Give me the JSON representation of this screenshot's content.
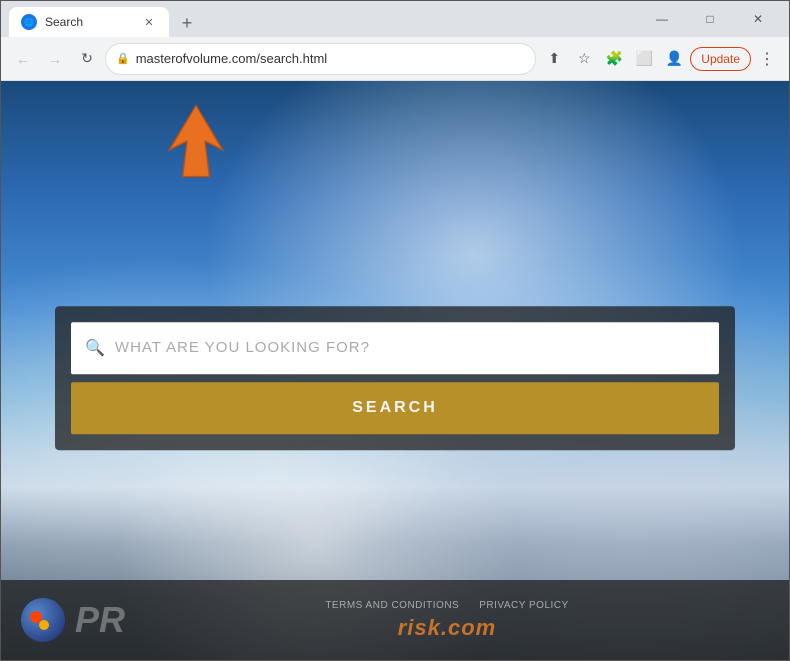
{
  "browser": {
    "tab": {
      "title": "Search",
      "favicon": "🌐"
    },
    "new_tab_label": "+",
    "window_controls": {
      "minimize": "—",
      "maximize": "□",
      "close": "✕"
    },
    "toolbar": {
      "back_label": "←",
      "forward_label": "→",
      "reload_label": "↻",
      "address": "masterofvolume.com/search.html",
      "share_label": "⬆",
      "bookmark_label": "☆",
      "extensions_label": "🧩",
      "tabs_label": "⬜",
      "profile_label": "👤",
      "update_label": "Update",
      "menu_label": "⋮"
    }
  },
  "page": {
    "search": {
      "placeholder": "WHAT ARE YOU LOOKING FOR?",
      "button_label": "SEARCH"
    },
    "footer": {
      "terms_label": "TERMS AND CONDITIONS",
      "privacy_label": "PRIVACY POLICY",
      "brand_label": "risk.com",
      "logo_text": "PR"
    }
  }
}
